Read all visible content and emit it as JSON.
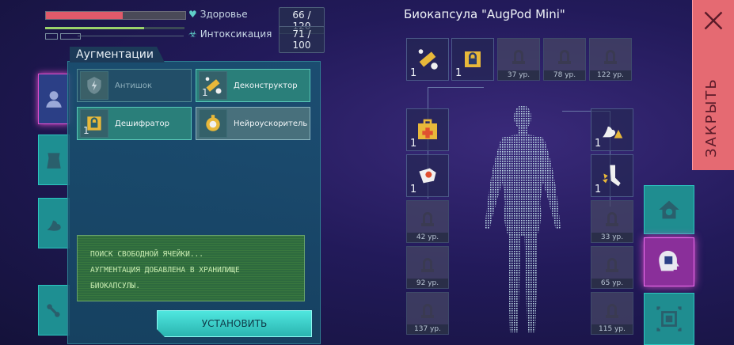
{
  "stats": {
    "health": {
      "label": "Здоровье",
      "value": "66 / 120",
      "fraction": 0.55,
      "icon": "heart-icon"
    },
    "intoxication": {
      "label": "Интоксикация",
      "value": "71 / 100",
      "fraction": 0.71,
      "icon": "biohazard-icon"
    }
  },
  "panel": {
    "title": "Аугментации",
    "augs": [
      {
        "name": "Антишок",
        "count": "",
        "state": "unavailable"
      },
      {
        "name": "Деконструктор",
        "count": "1",
        "state": "available"
      },
      {
        "name": "Дешифратор",
        "count": "1",
        "state": "available"
      },
      {
        "name": "Нейроускоритель",
        "count": "",
        "state": "selected"
      }
    ],
    "log": [
      "ПОИСК СВОБОДНОЙ ЯЧЕЙКИ...",
      "АУГМЕНТАЦИЯ ДОБАВЛЕНА В ХРАНИЛИЩЕ",
      "БИОКАПСУЛЫ."
    ],
    "install_label": "УСТАНОВИТЬ"
  },
  "capsule": {
    "title": "Биокапсула \"AugPod Mini\"",
    "top_row": [
      {
        "count": "1",
        "level": "",
        "icon": "deconstructor-icon"
      },
      {
        "count": "1",
        "level": "",
        "icon": "decryptor-icon"
      },
      {
        "count": "",
        "level": "37 ур.",
        "icon": "lock-icon"
      },
      {
        "count": "",
        "level": "78 ур.",
        "icon": "lock-icon"
      },
      {
        "count": "",
        "level": "122 ур.",
        "icon": "lock-icon"
      }
    ],
    "left_col": [
      {
        "count": "1",
        "level": "",
        "icon": "medkit-icon"
      },
      {
        "count": "1",
        "level": "",
        "icon": "armor-icon"
      },
      {
        "count": "",
        "level": "42 ур.",
        "icon": "lock-icon"
      },
      {
        "count": "",
        "level": "92 ур.",
        "icon": "lock-icon"
      },
      {
        "count": "",
        "level": "137 ур.",
        "icon": "lock-icon"
      }
    ],
    "right_col": [
      {
        "count": "1",
        "level": "",
        "icon": "strength-icon"
      },
      {
        "count": "1",
        "level": "",
        "icon": "leg-icon"
      },
      {
        "count": "",
        "level": "33 ур.",
        "icon": "lock-icon"
      },
      {
        "count": "",
        "level": "65 ур.",
        "icon": "lock-icon"
      },
      {
        "count": "",
        "level": "115 ур.",
        "icon": "lock-icon"
      }
    ]
  },
  "close_label": "ЗАКРЫТЬ",
  "colors": {
    "accent": "#2bc6c0",
    "active": "#e34fcf",
    "close": "#e56a72",
    "health": "#e05a6a",
    "tox": "#9ad36a"
  }
}
